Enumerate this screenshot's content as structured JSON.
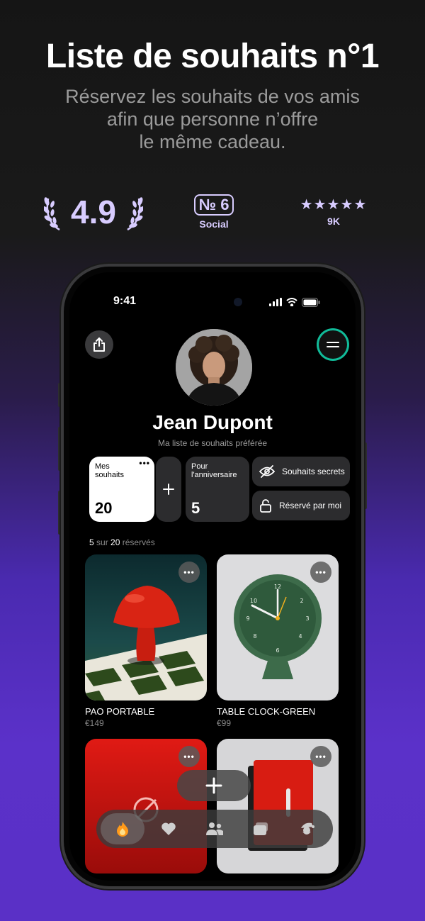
{
  "promo": {
    "title": "Liste de souhaits n°1",
    "subtitle_lines": [
      "Réservez les souhaits de vos amis",
      "afin que personne n’offre",
      "le même cadeau."
    ]
  },
  "awards": {
    "rating": "4.9",
    "rank_badge": "№ 6",
    "rank_label": "Social",
    "stars": "★★★★★",
    "reviews": "9K"
  },
  "status_bar": {
    "time": "9:41"
  },
  "profile": {
    "name": "Jean Dupont",
    "tagline": "Ma liste de souhaits préférée"
  },
  "lists": [
    {
      "title": "Mes souhaits",
      "count": "20",
      "more": "•••"
    },
    {
      "title": "Pour l'anniversaire",
      "count": "5"
    }
  ],
  "filters": {
    "secret": "Souhaits secrets",
    "reserved_by_me": "Réservé par moi"
  },
  "reserved_summary": {
    "count": "5",
    "sep": "sur",
    "total": "20",
    "suffix": "réservés"
  },
  "items": [
    {
      "name": "PAO PORTABLE",
      "price": "€149"
    },
    {
      "name": "TABLE CLOCK-GREEN",
      "price": "€99"
    },
    {
      "name": "",
      "price": ""
    },
    {
      "name": "",
      "price": ""
    }
  ],
  "more_label": "•••",
  "colors": {
    "accent": "#5b31c9",
    "lavender": "#d8ccff",
    "card_white": "#ffffff",
    "card_dark": "#2c2c2e"
  },
  "tabs": [
    {
      "icon": "flame-icon",
      "active": true
    },
    {
      "icon": "heart-icon"
    },
    {
      "icon": "friends-icon"
    },
    {
      "icon": "cards-icon"
    },
    {
      "icon": "santa-icon"
    }
  ]
}
